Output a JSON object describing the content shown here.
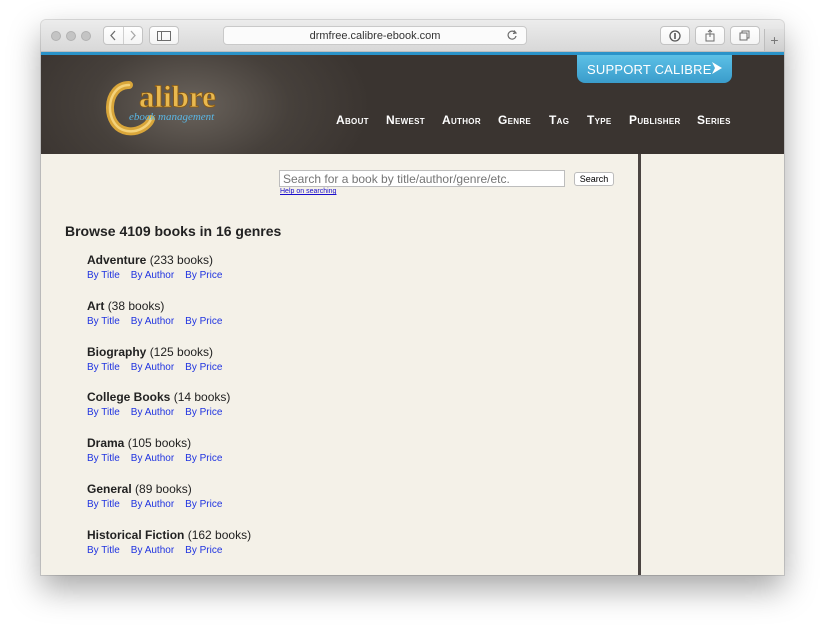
{
  "browser": {
    "url": "drmfree.calibre-ebook.com",
    "new_tab_icon": "+"
  },
  "site": {
    "logo_text": "alibre",
    "logo_tagline": "ebook management",
    "support_label": "SUPPORT CALIBRE",
    "nav": [
      "About",
      "Newest",
      "Author",
      "Genre",
      "Tag",
      "Type",
      "Publisher",
      "Series"
    ]
  },
  "search": {
    "placeholder": "Search for a book by title/author/genre/etc.",
    "button": "Search",
    "help": "Help on searching"
  },
  "browse_title": "Browse 4109 books in 16 genres",
  "genres": [
    {
      "name": "Adventure",
      "count": "(233 books)"
    },
    {
      "name": "Art",
      "count": "(38 books)"
    },
    {
      "name": "Biography",
      "count": "(125 books)"
    },
    {
      "name": "College Books",
      "count": "(14 books)"
    },
    {
      "name": "Drama",
      "count": "(105 books)"
    },
    {
      "name": "General",
      "count": "(89 books)"
    },
    {
      "name": "Historical Fiction",
      "count": "(162 books)"
    }
  ],
  "sort_links": [
    "By Title",
    "By Author",
    "By Price"
  ]
}
